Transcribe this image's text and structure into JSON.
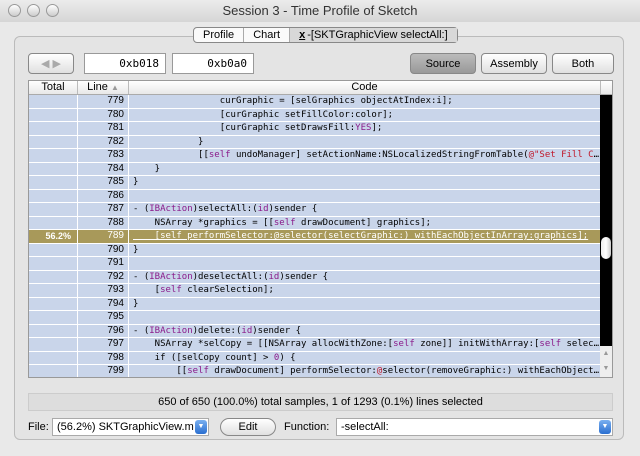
{
  "window": {
    "title": "Session 3 - Time Profile of Sketch"
  },
  "tabs": [
    {
      "label": "Profile"
    },
    {
      "label": "Chart"
    },
    {
      "label": "-[SKTGraphicView selectAll:]",
      "close": "x"
    }
  ],
  "toolbar": {
    "addr_start": "0xb018",
    "addr_end": "0xb0a0",
    "source": "Source",
    "assembly": "Assembly",
    "both": "Both",
    "active": "Source"
  },
  "table": {
    "headers": {
      "total": "Total",
      "line": "Line",
      "code": "Code"
    },
    "rows": [
      {
        "total": "",
        "line": "779",
        "code": [
          [
            "                curGraphic = [selGraphics objectAtIndex:i];",
            ""
          ]
        ]
      },
      {
        "total": "",
        "line": "780",
        "code": [
          [
            "                [curGraphic setFillColor:color];",
            ""
          ]
        ]
      },
      {
        "total": "",
        "line": "781",
        "code": [
          [
            "                [curGraphic setDrawsFill:",
            ""
          ],
          [
            "YES",
            "kw"
          ],
          [
            "];",
            ""
          ]
        ]
      },
      {
        "total": "",
        "line": "782",
        "code": [
          [
            "            }",
            ""
          ]
        ]
      },
      {
        "total": "",
        "line": "783",
        "code": [
          [
            "            [[",
            ""
          ],
          [
            "self",
            "kw"
          ],
          [
            " undoManager] setActionName:NSLocalizedStringFromTable(",
            ""
          ],
          [
            "@\"Set Fill Color…",
            "str"
          ]
        ]
      },
      {
        "total": "",
        "line": "784",
        "code": [
          [
            "    }",
            ""
          ]
        ]
      },
      {
        "total": "",
        "line": "785",
        "code": [
          [
            "}",
            ""
          ]
        ]
      },
      {
        "total": "",
        "line": "786",
        "code": []
      },
      {
        "total": "",
        "line": "787",
        "code": [
          [
            "- (",
            ""
          ],
          [
            "IBAction",
            "kw"
          ],
          [
            ")selectAll:(",
            ""
          ],
          [
            "id",
            "kw"
          ],
          [
            ")sender {",
            ""
          ]
        ]
      },
      {
        "total": "",
        "line": "788",
        "code": [
          [
            "    NSArray *graphics = [[",
            ""
          ],
          [
            "self",
            "kw"
          ],
          [
            " drawDocument] graphics];",
            ""
          ]
        ]
      },
      {
        "total": "56.2%",
        "line": "789",
        "selected": true,
        "code": [
          [
            "    [self performSelector:@selector(selectGraphic:) withEachObjectInArray:graphics];",
            ""
          ]
        ]
      },
      {
        "total": "",
        "line": "790",
        "code": [
          [
            "}",
            ""
          ]
        ]
      },
      {
        "total": "",
        "line": "791",
        "code": []
      },
      {
        "total": "",
        "line": "792",
        "code": [
          [
            "- (",
            ""
          ],
          [
            "IBAction",
            "kw"
          ],
          [
            ")deselectAll:(",
            ""
          ],
          [
            "id",
            "kw"
          ],
          [
            ")sender {",
            ""
          ]
        ]
      },
      {
        "total": "",
        "line": "793",
        "code": [
          [
            "    [",
            ""
          ],
          [
            "self",
            "kw"
          ],
          [
            " clearSelection];",
            ""
          ]
        ]
      },
      {
        "total": "",
        "line": "794",
        "code": [
          [
            "}",
            ""
          ]
        ]
      },
      {
        "total": "",
        "line": "795",
        "code": []
      },
      {
        "total": "",
        "line": "796",
        "code": [
          [
            "- (",
            ""
          ],
          [
            "IBAction",
            "kw"
          ],
          [
            ")delete:(",
            ""
          ],
          [
            "id",
            "kw"
          ],
          [
            ")sender {",
            ""
          ]
        ]
      },
      {
        "total": "",
        "line": "797",
        "code": [
          [
            "    NSArray *selCopy = [[NSArray allocWithZone:[",
            ""
          ],
          [
            "self",
            "kw"
          ],
          [
            " zone]] initWithArray:[",
            ""
          ],
          [
            "self",
            "kw"
          ],
          [
            " selec…",
            ""
          ]
        ]
      },
      {
        "total": "",
        "line": "798",
        "code": [
          [
            "    if ([selCopy count] > ",
            ""
          ],
          [
            "0",
            "kw"
          ],
          [
            ") {",
            ""
          ]
        ]
      },
      {
        "total": "",
        "line": "799",
        "code": [
          [
            "        [[",
            ""
          ],
          [
            "self",
            "kw"
          ],
          [
            " drawDocument] performSelector:",
            ""
          ],
          [
            "@",
            "str"
          ],
          [
            "selector(removeGraphic:) withEachObject…",
            ""
          ]
        ]
      }
    ]
  },
  "status": "650 of 650 (100.0%) total samples, 1 of 1293 (0.1%) lines selected",
  "footer": {
    "file_label": "File:",
    "file_value": "(56.2%) SKTGraphicView.m",
    "edit": "Edit",
    "function_label": "Function:",
    "function_value": "-selectAll:"
  },
  "colors": {
    "row": "#c9d5ea",
    "selected_row": "#a8995a",
    "keyword": "#8a1a8a",
    "string": "#c0182a"
  }
}
